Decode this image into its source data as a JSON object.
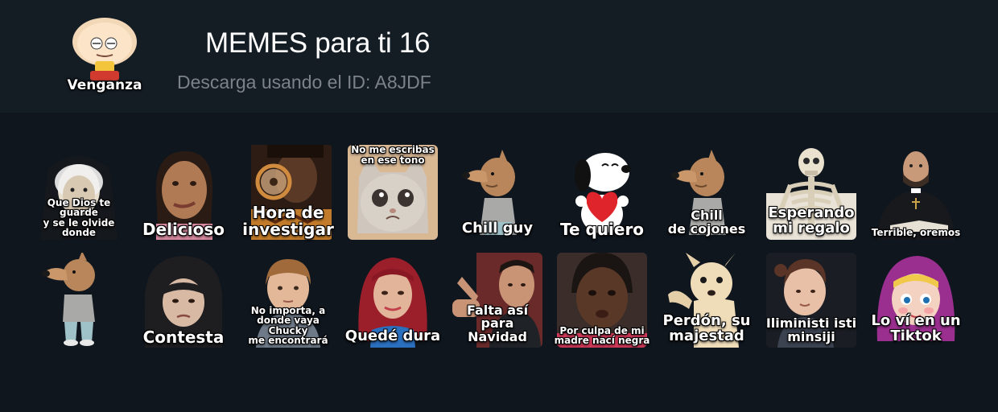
{
  "pack": {
    "title": "MEMES para ti 16",
    "subtitle": "Descarga usando el ID: A8JDF",
    "icon_label": "Venganza",
    "icon": "cartoon-baby-icon"
  },
  "stickers": [
    {
      "caption": "Que Dios te guarde\ny se le olvide\ndonde",
      "icon": "dog-nun-sticker"
    },
    {
      "caption": "Delicioso",
      "icon": "woman-face-sticker"
    },
    {
      "caption": "Hora de\ninvestigar",
      "icon": "magnifying-glass-man-sticker"
    },
    {
      "caption": "No me escribas\nen ese tono",
      "icon": "crying-cat-sticker"
    },
    {
      "caption": "Chill guy",
      "icon": "chill-guy-dog-sticker"
    },
    {
      "caption": "Te quiero",
      "icon": "snoopy-heart-sticker"
    },
    {
      "caption": "Chill\nde cojones",
      "icon": "chill-guy-dog-sticker"
    },
    {
      "caption": "Esperando\nmi regalo",
      "icon": "skeleton-sticker"
    },
    {
      "caption": "Terrible, oremos",
      "icon": "priest-sticker"
    },
    {
      "caption": "",
      "icon": "chill-guy-dog-full-sticker"
    },
    {
      "caption": "Contesta",
      "icon": "angry-girl-sticker"
    },
    {
      "caption": "No importa, a\ndonde vaya Chucky\nme encontrará",
      "icon": "boy-sticker"
    },
    {
      "caption": "Quedé dura",
      "icon": "red-hair-woman-sticker"
    },
    {
      "caption": "Falta así para\nNavidad",
      "icon": "man-gesture-sticker"
    },
    {
      "caption": "Por culpa de mi\nmadre nací negra",
      "icon": "girl-face-sticker"
    },
    {
      "caption": "Perdón, su\nmajestad",
      "icon": "chihuahua-sticker"
    },
    {
      "caption": "Iliministi isti\nminsiji",
      "icon": "baby-sticker"
    },
    {
      "caption": "Lo ví en un\nTiktok",
      "icon": "masha-sticker"
    }
  ],
  "colors": {
    "background": "#0f161e",
    "header": "#141c24",
    "title": "#ffffff",
    "subtitle": "#7b828a"
  }
}
